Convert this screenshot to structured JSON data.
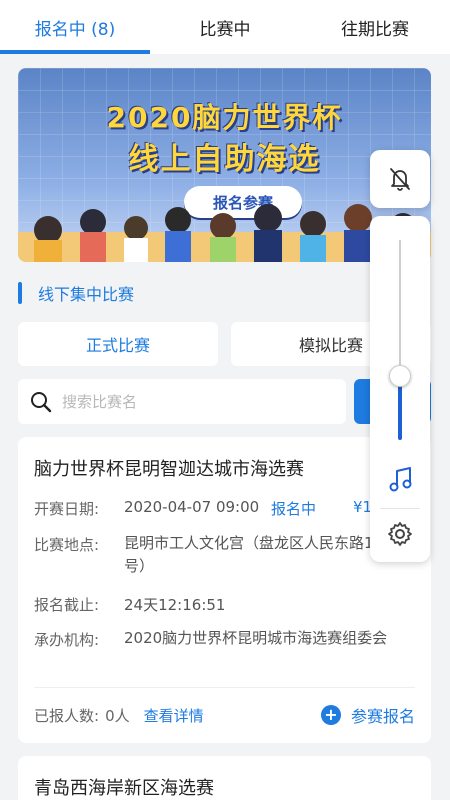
{
  "tabs": [
    {
      "label": "报名中 (8)",
      "active": true
    },
    {
      "label": "比赛中",
      "active": false
    },
    {
      "label": "往期比赛",
      "active": false
    }
  ],
  "banner": {
    "title_line1": "2020脑力世界杯",
    "title_line2": "线上自助海选",
    "cta_label": "报名参赛"
  },
  "section": {
    "title": "线下集中比赛"
  },
  "subtabs": [
    {
      "label": "正式比赛",
      "active": true
    },
    {
      "label": "模拟比赛",
      "active": false
    }
  ],
  "search": {
    "placeholder": "搜索比赛名",
    "value": ""
  },
  "cards": [
    {
      "title": "脑力世界杯昆明智迦达城市海选赛",
      "start_label": "开赛日期:",
      "start_value": "2020-04-07 09:00",
      "status": "报名中",
      "fee": "¥1",
      "venue_label": "比赛地点:",
      "venue_value": "昆明市工人文化宫（盘龙区人民东路198号）",
      "deadline_label": "报名截止:",
      "deadline_value": "24天12:16:51",
      "organizer_label": "承办机构:",
      "organizer_value": "2020脑力世界杯昆明城市海选赛组委会",
      "registered_label": "已报人数:",
      "registered_value": "0人",
      "details_link": "查看详情",
      "signup_label": "参赛报名"
    },
    {
      "title": "青岛西海岸新区海选赛"
    }
  ],
  "system_panel": {
    "top_icon": "bell-off-icon",
    "volume_level": 0.32,
    "mid_icon": "music-note-icon",
    "bottom_icon": "gear-icon"
  },
  "colors": {
    "accent": "#1e7be0",
    "background": "#f2f3f5"
  }
}
